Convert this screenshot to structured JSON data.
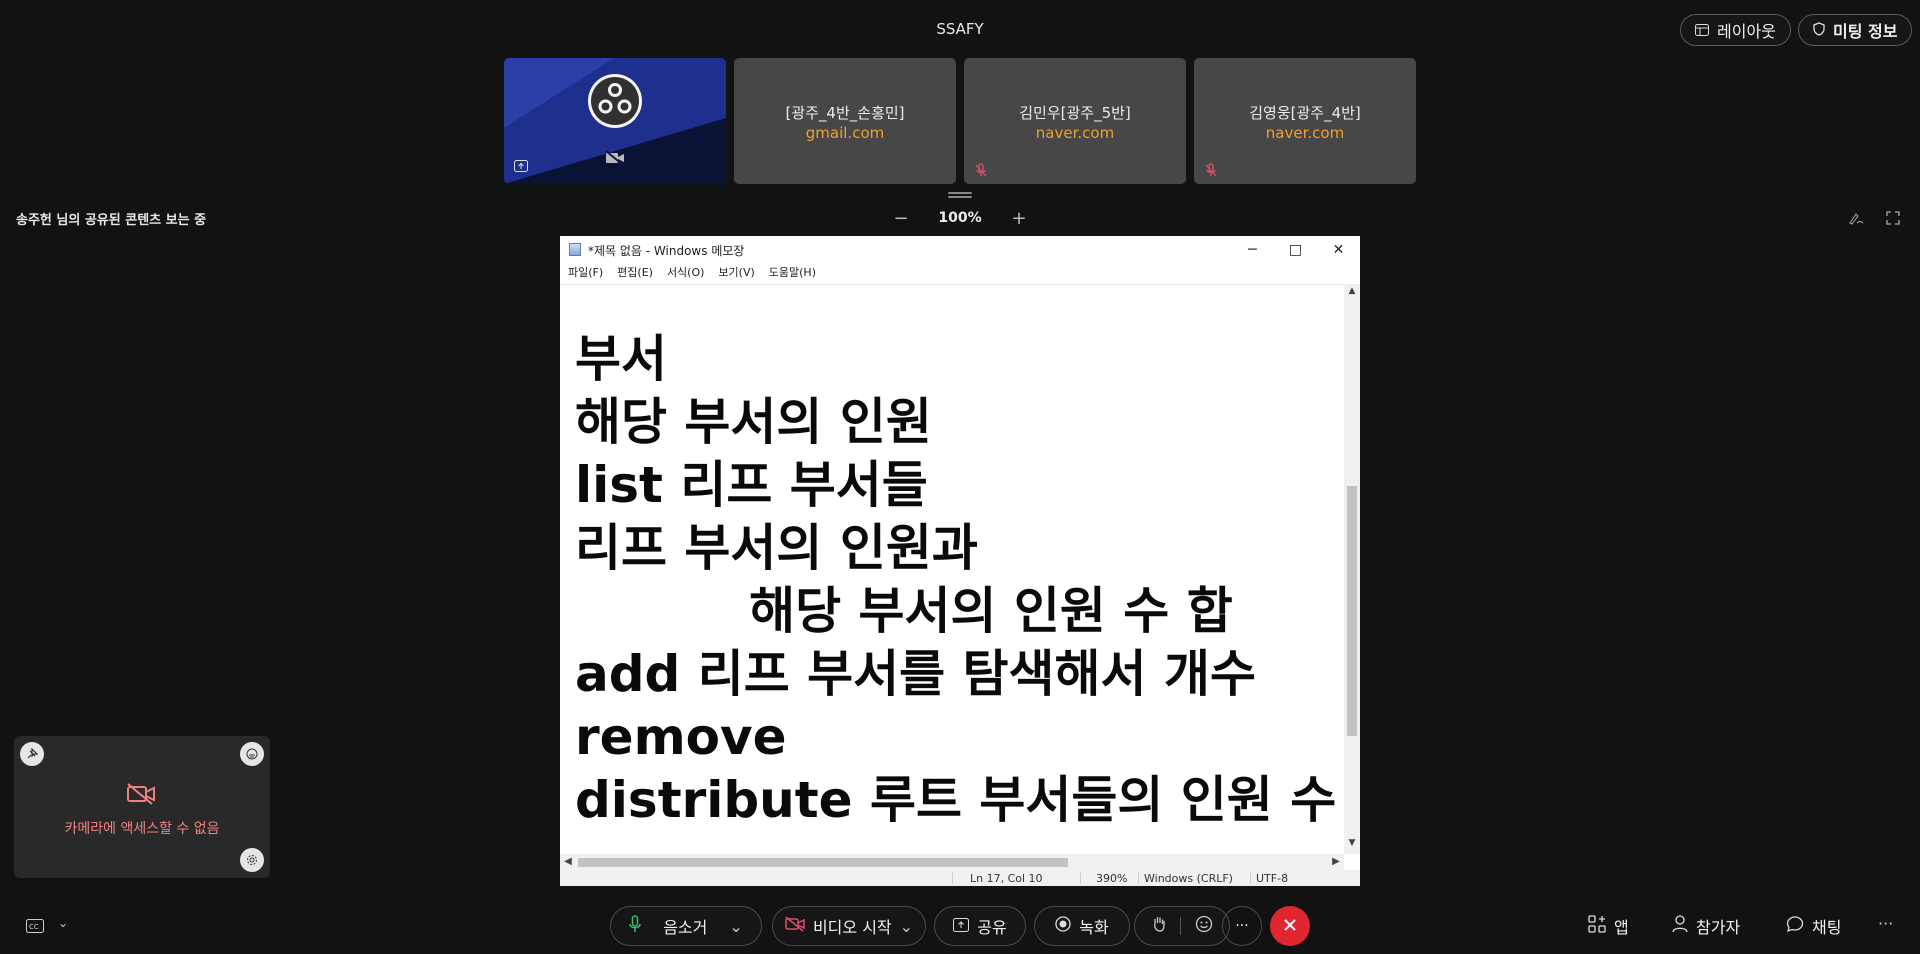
{
  "header": {
    "title": "SSAFY",
    "layout_label": "레이아웃",
    "meeting_info_label": "미팅 정보"
  },
  "participants": [
    {
      "name": "[광주_4반_손홍민]",
      "email": "gmail.com"
    },
    {
      "name": "김민우[광주_5반]",
      "email": "naver.com"
    },
    {
      "name": "김영웅[광주_4반]",
      "email": "naver.com"
    }
  ],
  "share": {
    "viewing_label": "송주헌 님의 공유된 콘텐츠 보는 중",
    "zoom": "100%",
    "zoom_out": "−",
    "zoom_in": "+"
  },
  "notepad": {
    "title": "*제목 없음 - Windows 메모장",
    "menu": [
      "파일(F)",
      "편집(E)",
      "서식(O)",
      "보기(V)",
      "도움말(H)"
    ],
    "lines": [
      "부서",
      "해당 부서의 인원",
      "list 리프 부서들",
      "리프 부서의 인원과",
      "          해당 부서의 인원 수 합",
      "add 리프 부서를 탐색해서 개수",
      "remove",
      "distribute 루트 부서들의 인원 수 합"
    ],
    "status": {
      "position": "Ln 17, Col 10",
      "zoom": "390%",
      "line_ending": "Windows (CRLF)",
      "encoding": "UTF-8"
    }
  },
  "self_view": {
    "camera_message": "카메라에 액세스할 수 없음"
  },
  "controls": {
    "mute_label": "음소거",
    "video_label": "비디오 시작",
    "share_label": "공유",
    "record_label": "녹화",
    "more_label": "···",
    "apps_label": "앱",
    "participants_label": "참가자",
    "chat_label": "채팅",
    "overflow_label": "···"
  },
  "colors": {
    "accent_orange": "#f0a030",
    "mute_red": "#e0506a",
    "end_red": "#e0262e",
    "mic_green": "#33c36b"
  }
}
